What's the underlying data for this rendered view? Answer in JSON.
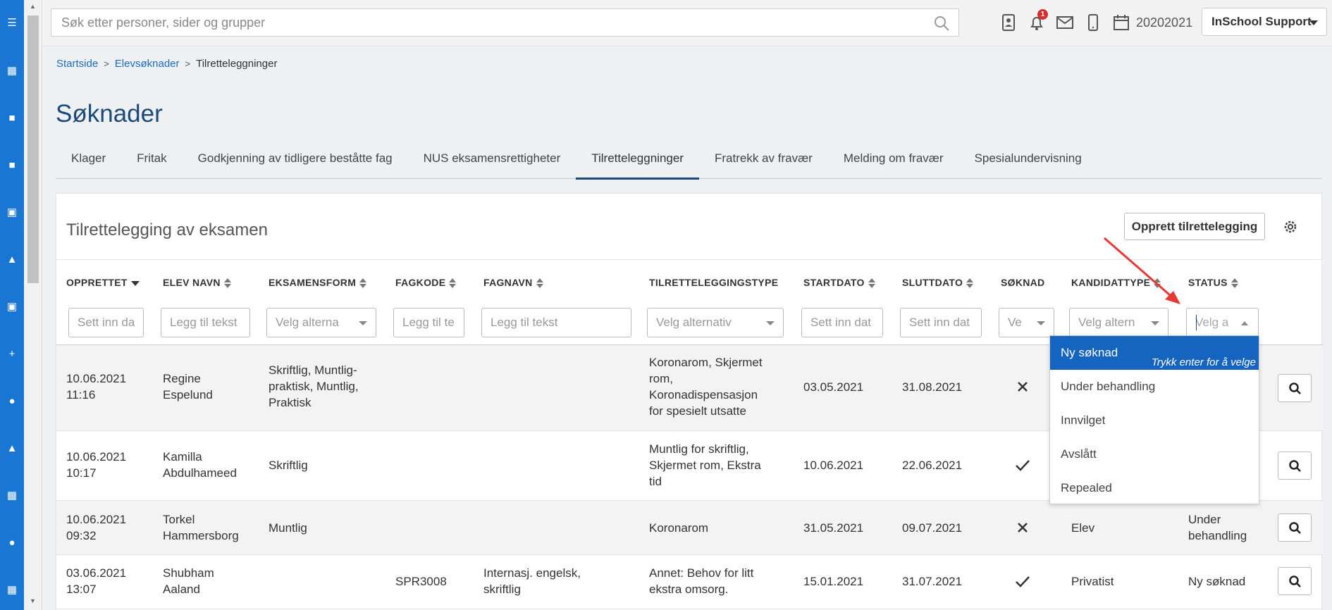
{
  "topbar": {
    "search_placeholder": "Søk etter personer, sider og grupper",
    "notification_count": "1",
    "year": "20202021",
    "user": "InSchool Support"
  },
  "breadcrumb": {
    "home": "Startside",
    "parent": "Elevsøknader",
    "current": "Tilretteleggninger"
  },
  "page": {
    "title": "Søknader"
  },
  "tabs": [
    {
      "label": "Klager"
    },
    {
      "label": "Fritak"
    },
    {
      "label": "Godkjenning av tidligere beståtte fag"
    },
    {
      "label": "NUS eksamensrettigheter"
    },
    {
      "label": "Tilretteleggninger",
      "active": true
    },
    {
      "label": "Fratrekk av fravær"
    },
    {
      "label": "Melding om fravær"
    },
    {
      "label": "Spesialundervisning"
    }
  ],
  "panel": {
    "title": "Tilrettelegging av eksamen",
    "create_button": "Opprett tilrettelegging"
  },
  "columns": {
    "opprettet": "OPPRETTET",
    "elev_navn": "ELEV NAVN",
    "eksamensform": "EKSAMENSFORM",
    "fagkode": "FAGKODE",
    "fagnavn": "FAGNAVN",
    "type": "TILRETTELEGGINGSTYPE",
    "startdato": "STARTDATO",
    "sluttdato": "SLUTTDATO",
    "soknad": "SØKNAD",
    "kandidattype": "KANDIDATTYPE",
    "status": "STATUS"
  },
  "filters": {
    "opprettet": "Sett inn da",
    "elev_navn": "Legg til tekst",
    "eksamensform": "Velg alterna",
    "fagkode": "Legg til te",
    "fagnavn": "Legg til tekst",
    "type": "Velg alternativ",
    "startdato": "Sett inn dat",
    "sluttdato": "Sett inn dat",
    "soknad": "Ve",
    "kandidattype": "Velg altern",
    "status": "Velg a"
  },
  "rows": [
    {
      "date": "10.06.2021",
      "time": "11:16",
      "name1": "Regine",
      "name2": "Espelund",
      "form": [
        "Skriftlig, Muntlig-",
        "praktisk, Muntlig,",
        "Praktisk"
      ],
      "fagkode": "",
      "fagnavn": [],
      "type": [
        "Koronarom, Skjermet",
        "rom,",
        "Koronadispensasjon",
        "for spesielt utsatte"
      ],
      "start": "03.05.2021",
      "slutt": "31.08.2021",
      "soknad": "cross",
      "kandidat": "",
      "status": [
        "",
        ""
      ]
    },
    {
      "date": "10.06.2021",
      "time": "10:17",
      "name1": "Kamilla",
      "name2": "Abdulhameed",
      "form": [
        "Skriftlig"
      ],
      "fagkode": "",
      "fagnavn": [],
      "type": [
        "Muntlig for skriftlig,",
        "Skjermet rom, Ekstra",
        "tid"
      ],
      "start": "10.06.2021",
      "slutt": "22.06.2021",
      "soknad": "check",
      "kandidat": "",
      "status": [
        "",
        ""
      ]
    },
    {
      "date": "10.06.2021",
      "time": "09:32",
      "name1": "Torkel",
      "name2": "Hammersborg",
      "form": [
        "Muntlig"
      ],
      "fagkode": "",
      "fagnavn": [],
      "type": [
        "Koronarom"
      ],
      "start": "31.05.2021",
      "slutt": "09.07.2021",
      "soknad": "cross",
      "kandidat": "Elev",
      "status": [
        "Under",
        "behandling"
      ]
    },
    {
      "date": "03.06.2021",
      "time": "13:07",
      "name1": "Shubham",
      "name2": "Aaland",
      "form": [],
      "fagkode": "SPR3008",
      "fagnavn": [
        "Internasj. engelsk,",
        "skriftlig"
      ],
      "type": [
        "Annet: Behov for litt",
        "ekstra omsorg."
      ],
      "start": "15.01.2021",
      "slutt": "31.07.2021",
      "soknad": "check",
      "kandidat": "Privatist",
      "status": [
        "Ny søknad",
        ""
      ]
    }
  ],
  "status_dropdown": {
    "hint": "Trykk enter for å velge",
    "options": [
      "Ny søknad",
      "Under behandling",
      "Innvilget",
      "Avslått",
      "Repealed"
    ]
  },
  "colors": {
    "rail": "#1976d2",
    "accent": "#1a4a7a",
    "highlight": "#1565c0",
    "arrow": "#e53935"
  }
}
